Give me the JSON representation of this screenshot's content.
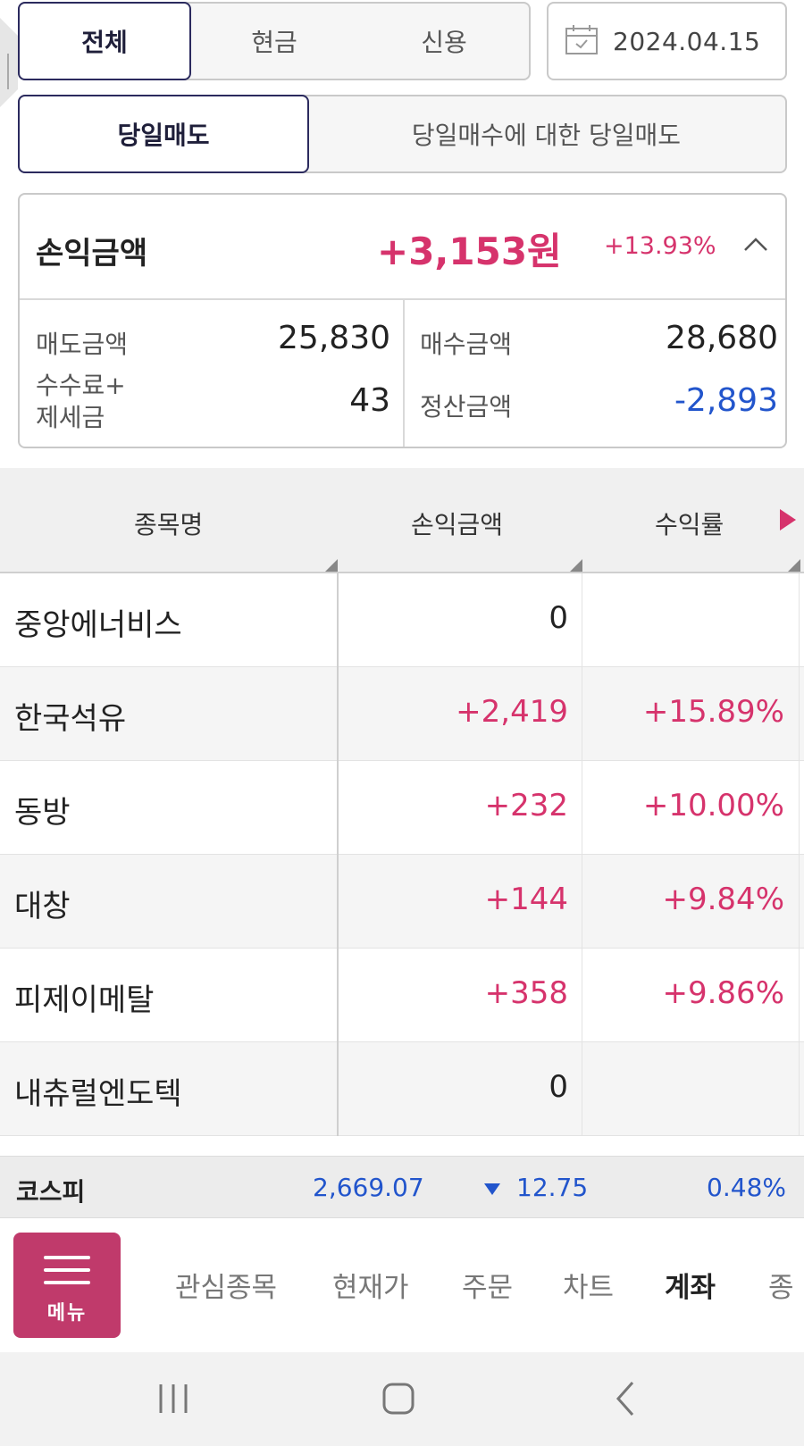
{
  "filter_tabs": [
    "전체",
    "현금",
    "신용"
  ],
  "date": "2024.04.15",
  "mode_tabs": [
    "당일매도",
    "당일매수에 대한 당일매도"
  ],
  "summary": {
    "label": "손익금액",
    "amount": "+3,153원",
    "rate": "+13.93%",
    "sell_label": "매도금액",
    "sell_value": "25,830",
    "buy_label": "매수금액",
    "buy_value": "28,680",
    "fee_label_line1": "수수료+",
    "fee_label_line2": "제세금",
    "fee_value": "43",
    "settle_label": "정산금액",
    "settle_value": "-2,893"
  },
  "table": {
    "headers": [
      "종목명",
      "손익금액",
      "수익률"
    ],
    "rows": [
      {
        "name": "중앙에너비스",
        "pl": "0",
        "rate": ""
      },
      {
        "name": "한국석유",
        "pl": "+2,419",
        "rate": "+15.89%"
      },
      {
        "name": "동방",
        "pl": "+232",
        "rate": "+10.00%"
      },
      {
        "name": "대창",
        "pl": "+144",
        "rate": "+9.84%"
      },
      {
        "name": "피제이메탈",
        "pl": "+358",
        "rate": "+9.86%"
      },
      {
        "name": "내츄럴엔도텍",
        "pl": "0",
        "rate": ""
      }
    ]
  },
  "index_bar": {
    "name": "코스피",
    "value": "2,669.07",
    "change": "12.75",
    "change_rate": "0.48%"
  },
  "bottom_nav": {
    "menu_label": "메뉴",
    "items": [
      "관심종목",
      "현재가",
      "주문",
      "차트",
      "계좌",
      "종"
    ]
  },
  "colors": {
    "accent": "#c03a6b",
    "profit": "#d6336c",
    "loss": "#2255cc",
    "tab_border": "#2b2a5e"
  }
}
